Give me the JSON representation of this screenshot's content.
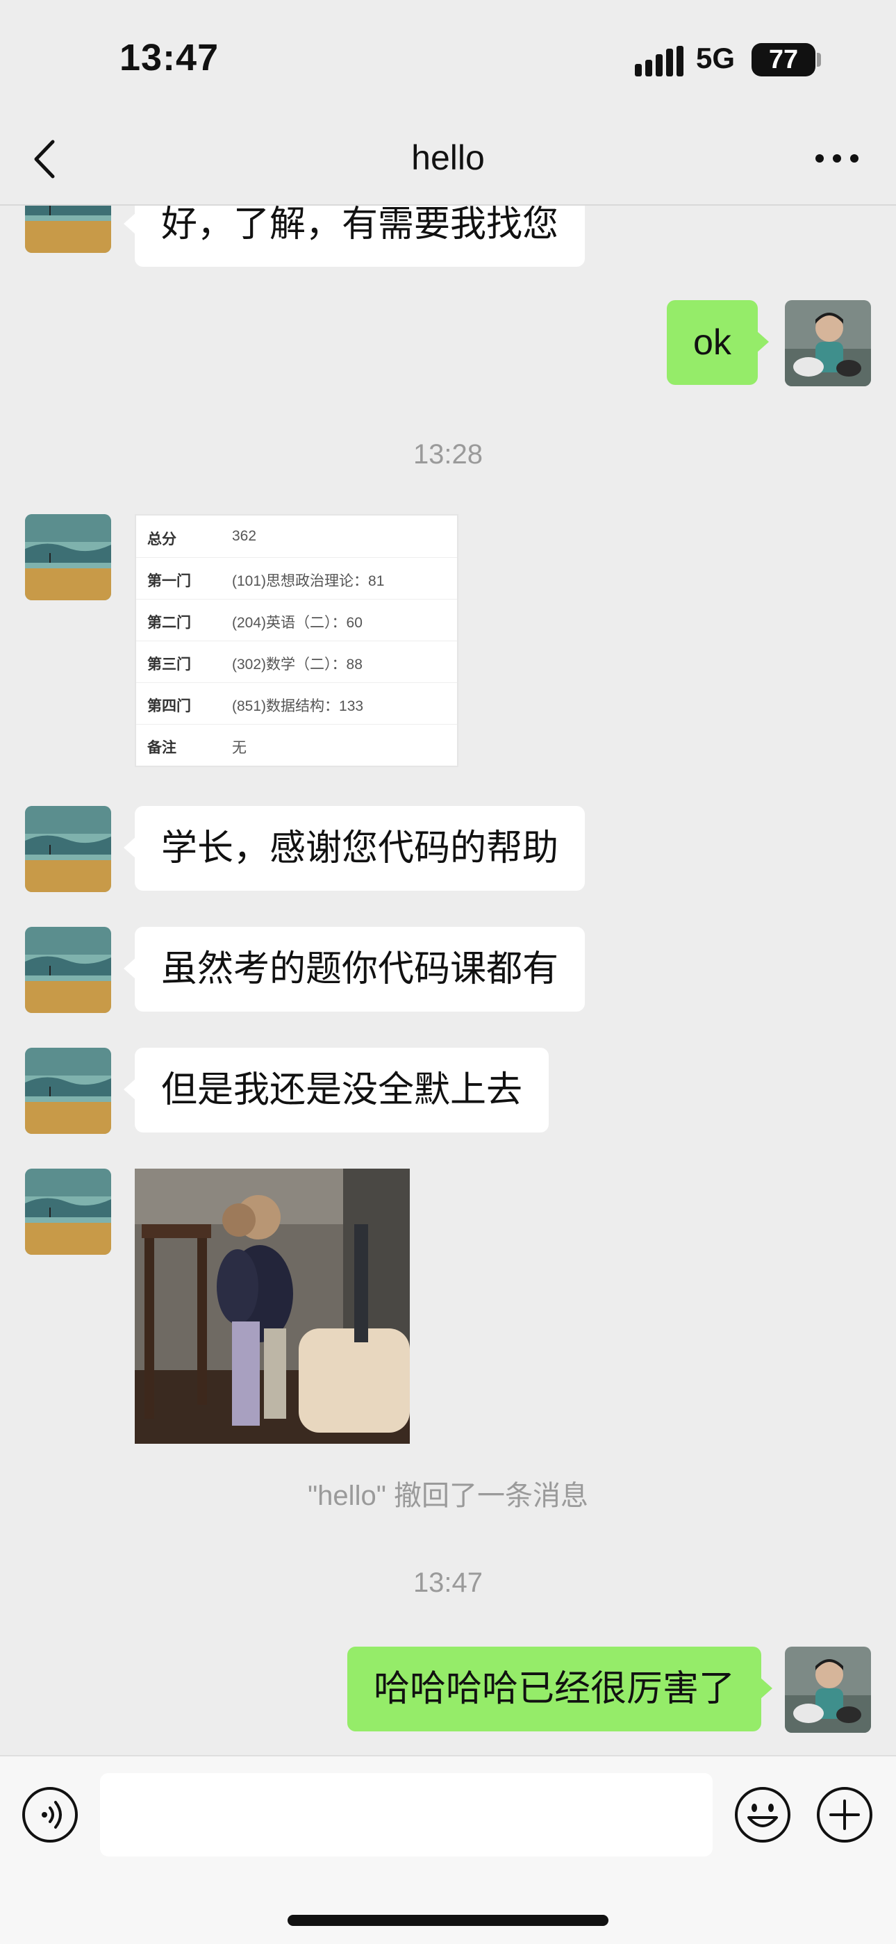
{
  "status_bar": {
    "time": "13:47",
    "network": "5G",
    "battery": "77"
  },
  "nav": {
    "title": "hello",
    "back_icon": "chevron-left-icon",
    "more_icon": "ellipsis-icon"
  },
  "messages": [
    {
      "type": "text",
      "direction": "in",
      "text": "好，了解，有需要我找您"
    },
    {
      "type": "text",
      "direction": "out",
      "text": "ok"
    },
    {
      "type": "timestamp",
      "text": "13:28"
    },
    {
      "type": "score_card",
      "direction": "in",
      "rows": [
        {
          "label": "总分",
          "value": "362"
        },
        {
          "label": "第一门",
          "value": "(101)思想政治理论：81"
        },
        {
          "label": "第二门",
          "value": "(204)英语（二）：60"
        },
        {
          "label": "第三门",
          "value": "(302)数学（二）：88"
        },
        {
          "label": "第四门",
          "value": "(851)数据结构：133"
        },
        {
          "label": "备注",
          "value": "无"
        }
      ]
    },
    {
      "type": "text",
      "direction": "in",
      "text": "学长，感谢您代码的帮助"
    },
    {
      "type": "text",
      "direction": "in",
      "text": "虽然考的题你代码课都有"
    },
    {
      "type": "text",
      "direction": "in",
      "text": "但是我还是没全默上去"
    },
    {
      "type": "image",
      "direction": "in"
    },
    {
      "type": "system",
      "text": "\"hello\" 撤回了一条消息"
    },
    {
      "type": "timestamp",
      "text": "13:47"
    },
    {
      "type": "text",
      "direction": "out",
      "text": "哈哈哈哈已经很厉害了"
    }
  ],
  "input_bar": {
    "placeholder": "",
    "voice_icon": "voice-icon",
    "emoji_icon": "emoji-icon",
    "plus_icon": "plus-icon"
  },
  "colors": {
    "background": "#ededed",
    "outgoing_bubble": "#95ec69",
    "incoming_bubble": "#ffffff"
  }
}
